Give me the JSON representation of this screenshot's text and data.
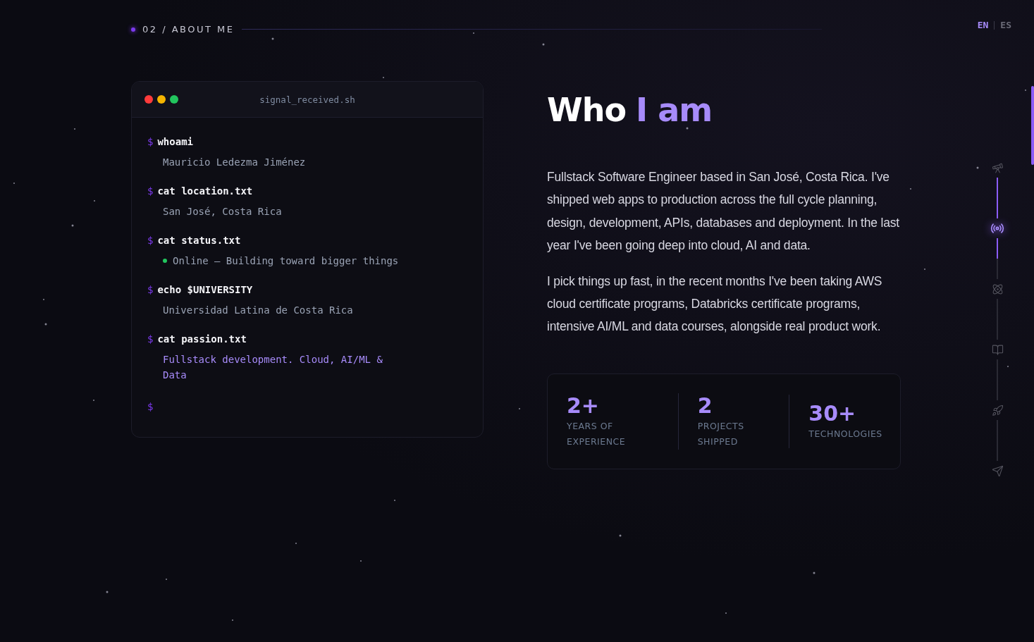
{
  "section_label": {
    "number": "02",
    "separator": "/",
    "title": "ABOUT ME"
  },
  "languages": [
    {
      "label": "EN",
      "selected": true
    },
    {
      "label": "ES",
      "selected": false
    }
  ],
  "terminal": {
    "filename": "signal_received.sh",
    "prompt": "$",
    "entries": [
      {
        "command": "whoami",
        "output": "Mauricio Ledezma Jiménez",
        "kind": "plain"
      },
      {
        "command": "cat location.txt",
        "output": "San José, Costa Rica",
        "kind": "plain"
      },
      {
        "command": "cat status.txt",
        "output": "Online — Building toward bigger things",
        "kind": "status",
        "color": "#22c55e"
      },
      {
        "command": "echo $UNIVERSITY",
        "output": "Universidad Latina de Costa Rica",
        "kind": "plain"
      },
      {
        "command": "cat passion.txt",
        "output": "Fullstack development. Cloud, AI/ML & Data",
        "kind": "accent"
      }
    ]
  },
  "heading": {
    "lead": "Who",
    "accent": "I am"
  },
  "paragraphs": [
    "Fullstack Software Engineer based in San José, Costa Rica. I've shipped web apps to production across the full cycle planning, design, development, APIs, databases and deployment. In the last year I've been going deep into cloud, AI and data.",
    "I pick things up fast, in the recent months I've been taking AWS cloud certificate programs, Databricks certificate programs, intensive AI/ML and data courses, alongside real product work."
  ],
  "stats": [
    {
      "value": "2+",
      "label": "YEARS OF EXPERIENCE"
    },
    {
      "value": "2",
      "label": "PROJECTS SHIPPED"
    },
    {
      "value": "30+",
      "label": "TECHNOLOGIES"
    }
  ],
  "section_nav": [
    {
      "kind": "telescope",
      "selected": false
    },
    {
      "kind": "signal",
      "selected": true
    },
    {
      "kind": "atom",
      "selected": false
    },
    {
      "kind": "book",
      "selected": false
    },
    {
      "kind": "rocket",
      "selected": false
    },
    {
      "kind": "send",
      "selected": false
    }
  ]
}
